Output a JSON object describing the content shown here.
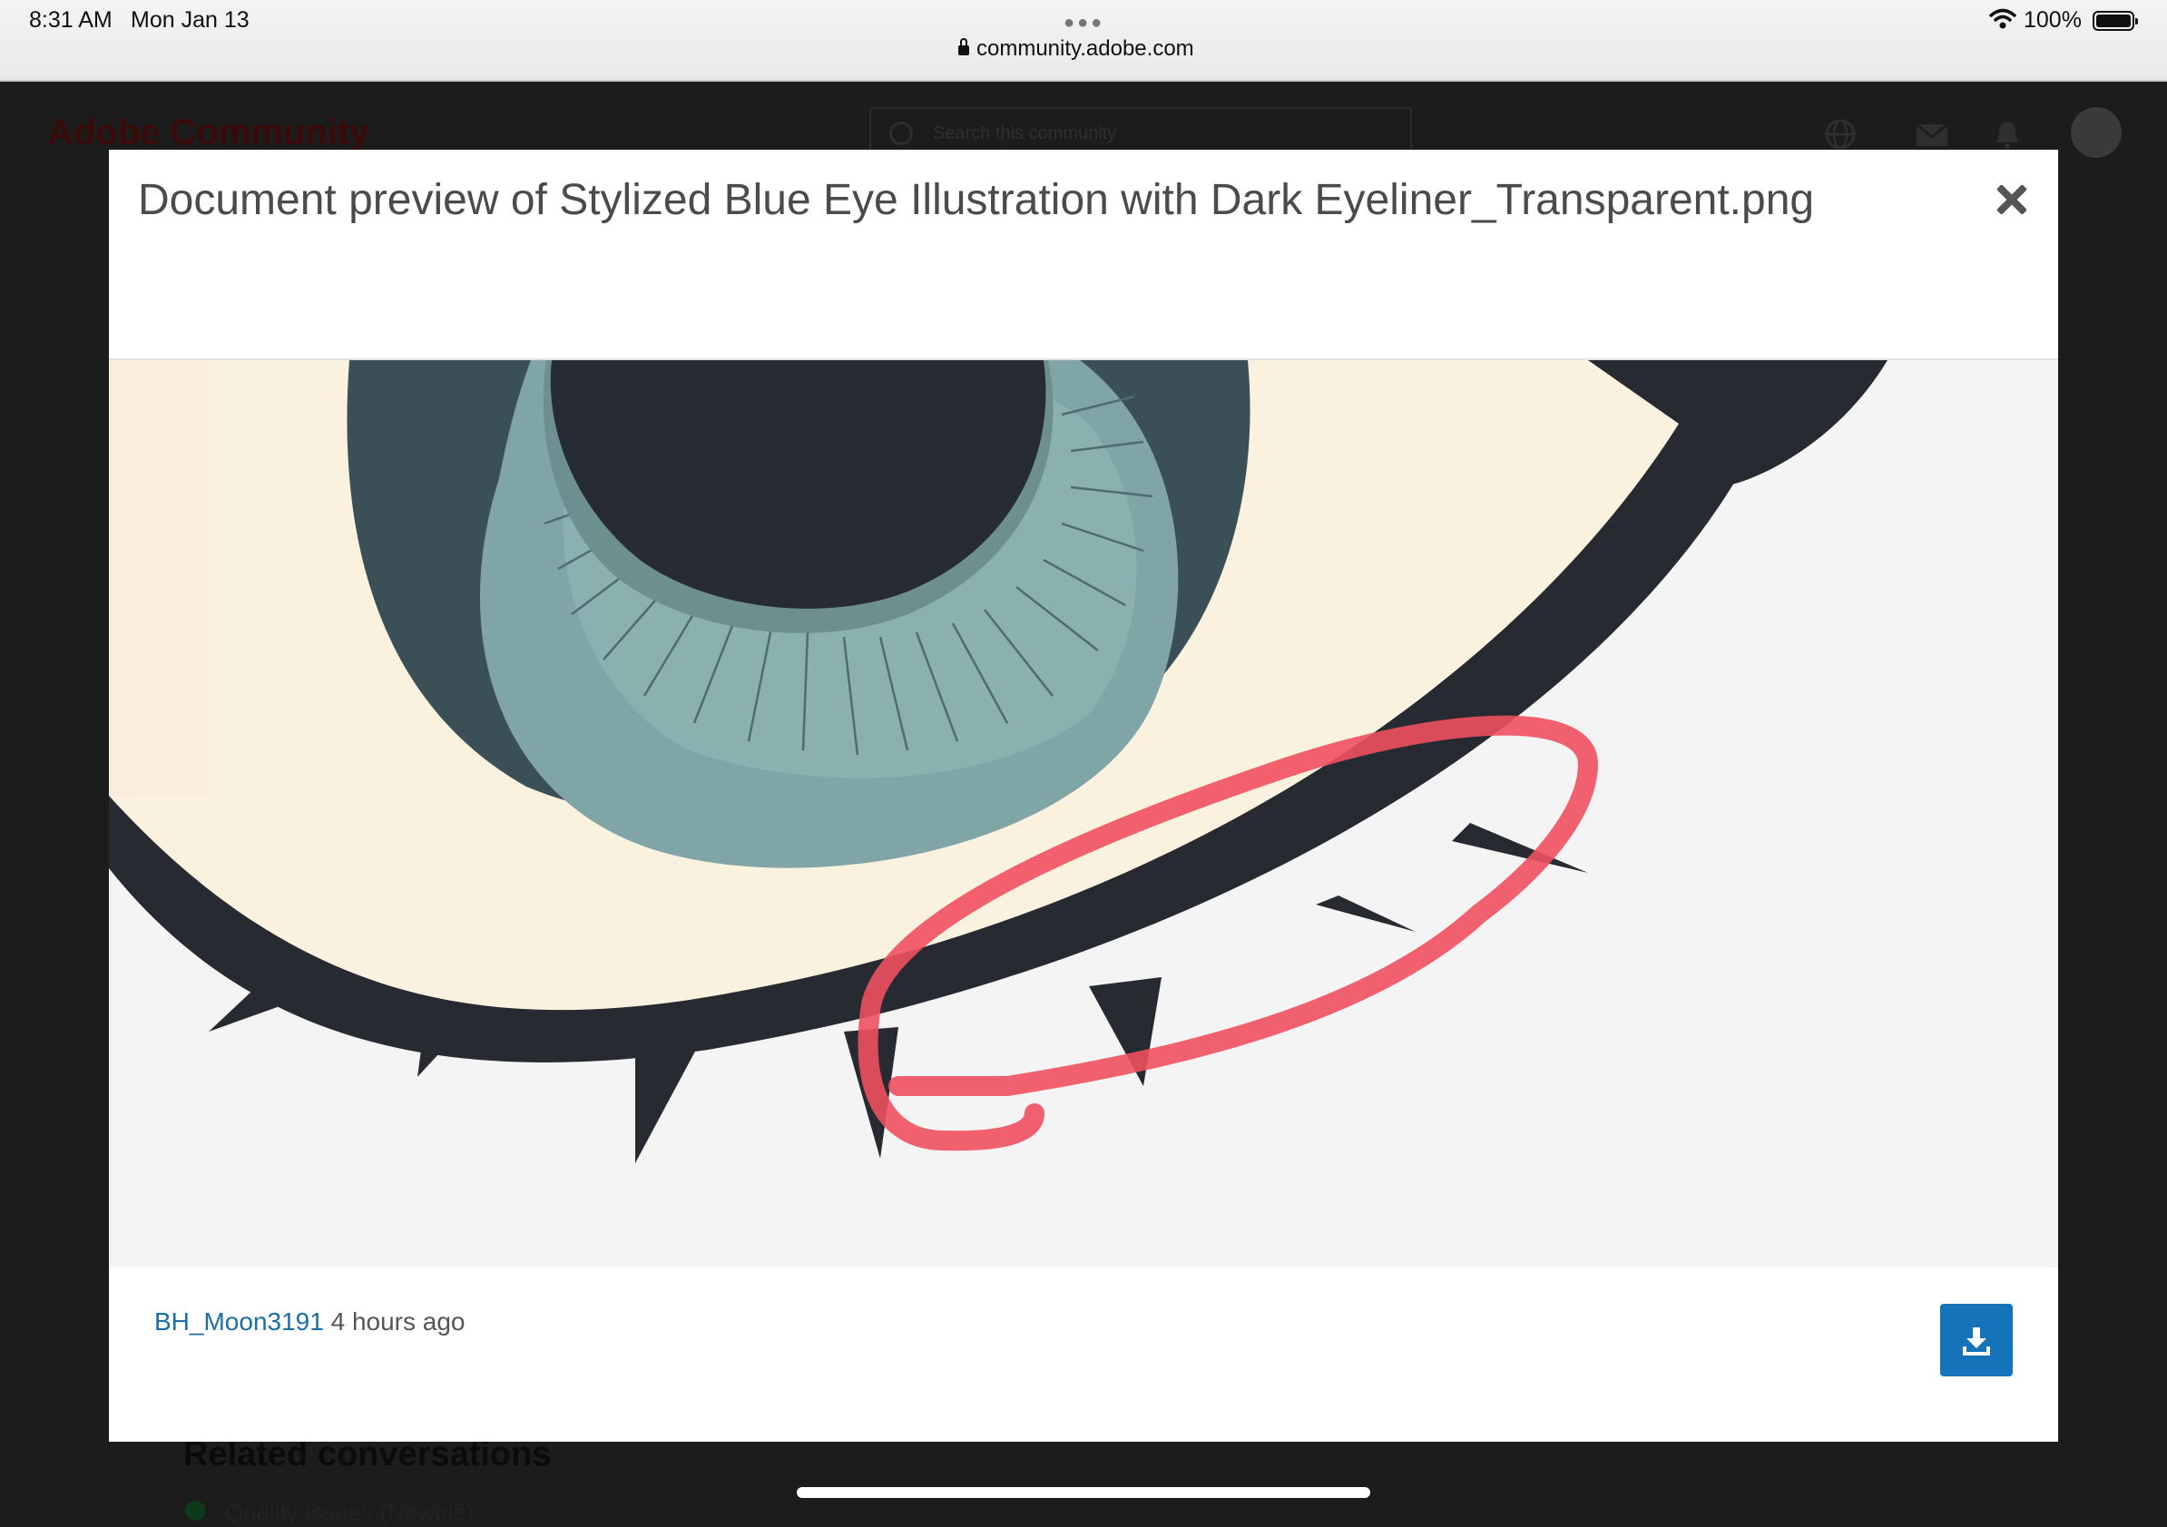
{
  "status_bar": {
    "time": "8:31 AM",
    "date": "Mon Jan 13",
    "url": "community.adobe.com",
    "battery_percent": "100%",
    "battery_level": 1.0
  },
  "background_page": {
    "logo": "Adobe Community",
    "search_placeholder": "Search this community",
    "icons": [
      "globe-icon",
      "mail-icon",
      "bell-icon"
    ],
    "related_heading": "Related conversations",
    "related_first_item": "Quality Issues (Newbie)"
  },
  "modal": {
    "title": "Document preview of Stylized Blue Eye Illustration with Dark Eyeliner_Transparent.png",
    "close_icon": "close-icon",
    "image_alt": "Stylized Blue Eye Illustration with Dark Eyeliner",
    "author": "BH_Moon3191",
    "posted": "4 hours ago",
    "download_icon": "download-icon"
  },
  "colors": {
    "link": "#1b6ea6",
    "download_button": "#1473b9",
    "annotation": "#f0505f"
  }
}
